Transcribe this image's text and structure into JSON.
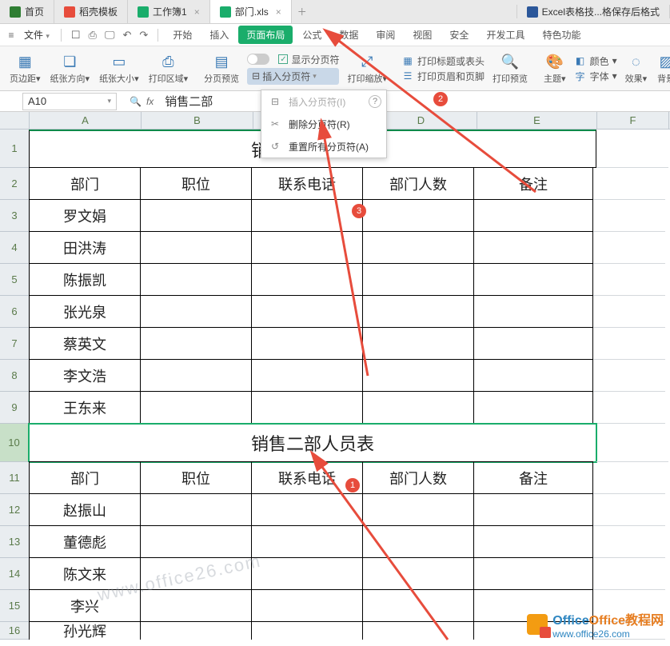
{
  "tabs": [
    {
      "label": "首页",
      "icon": "home"
    },
    {
      "label": "稻壳模板",
      "icon": "docer"
    },
    {
      "label": "工作簿1",
      "icon": "wps"
    },
    {
      "label": "部门.xls",
      "icon": "wps",
      "active": true
    },
    {
      "label": "Excel表格技...格保存后格式",
      "icon": "excel"
    }
  ],
  "menubar": {
    "file": "文件",
    "menus": [
      "开始",
      "插入",
      "页面布局",
      "公式",
      "数据",
      "审阅",
      "视图",
      "安全",
      "开发工具",
      "特色功能"
    ],
    "active_index": 2
  },
  "ribbon": {
    "margin": "页边距",
    "orient": "纸张方向",
    "size": "纸张大小",
    "area": "打印区域",
    "preview": "分页预览",
    "insert_break": "插入分页符",
    "scale": "打印缩放",
    "show_break": "显示分页符",
    "titles": "打印标题或表头",
    "header_footer": "打印页眉和页脚",
    "print_preview": "打印预览",
    "theme": "主题",
    "color": "颜色",
    "font": "字体",
    "effect": "效果",
    "bg": "背景"
  },
  "dropdown": {
    "insert": "插入分页符(I)",
    "delete": "删除分页符(R)",
    "reset": "重置所有分页符(A)"
  },
  "namebox": "A10",
  "formula": "销售二部",
  "cols": [
    "A",
    "B",
    "C",
    "D",
    "E",
    "F"
  ],
  "rows": [
    "1",
    "2",
    "3",
    "4",
    "5",
    "6",
    "7",
    "8",
    "9",
    "10",
    "11",
    "12",
    "13",
    "14",
    "15",
    "16"
  ],
  "sheet": {
    "title1": "销售一部人员表",
    "title2": "销售二部人员表",
    "hdr": [
      "部门",
      "职位",
      "联系电话",
      "部门人数",
      "备注"
    ],
    "names1": [
      "罗文娟",
      "田洪涛",
      "陈振凯",
      "张光泉",
      "蔡英文",
      "李文浩",
      "王东来"
    ],
    "names2": [
      "赵振山",
      "董德彪",
      "陈文来",
      "李兴",
      "孙光辉"
    ]
  },
  "badges": [
    "1",
    "2",
    "3"
  ],
  "watermark": "www.office26.com",
  "brand": {
    "name": "Office教程网",
    "url": "www.office26.com"
  }
}
